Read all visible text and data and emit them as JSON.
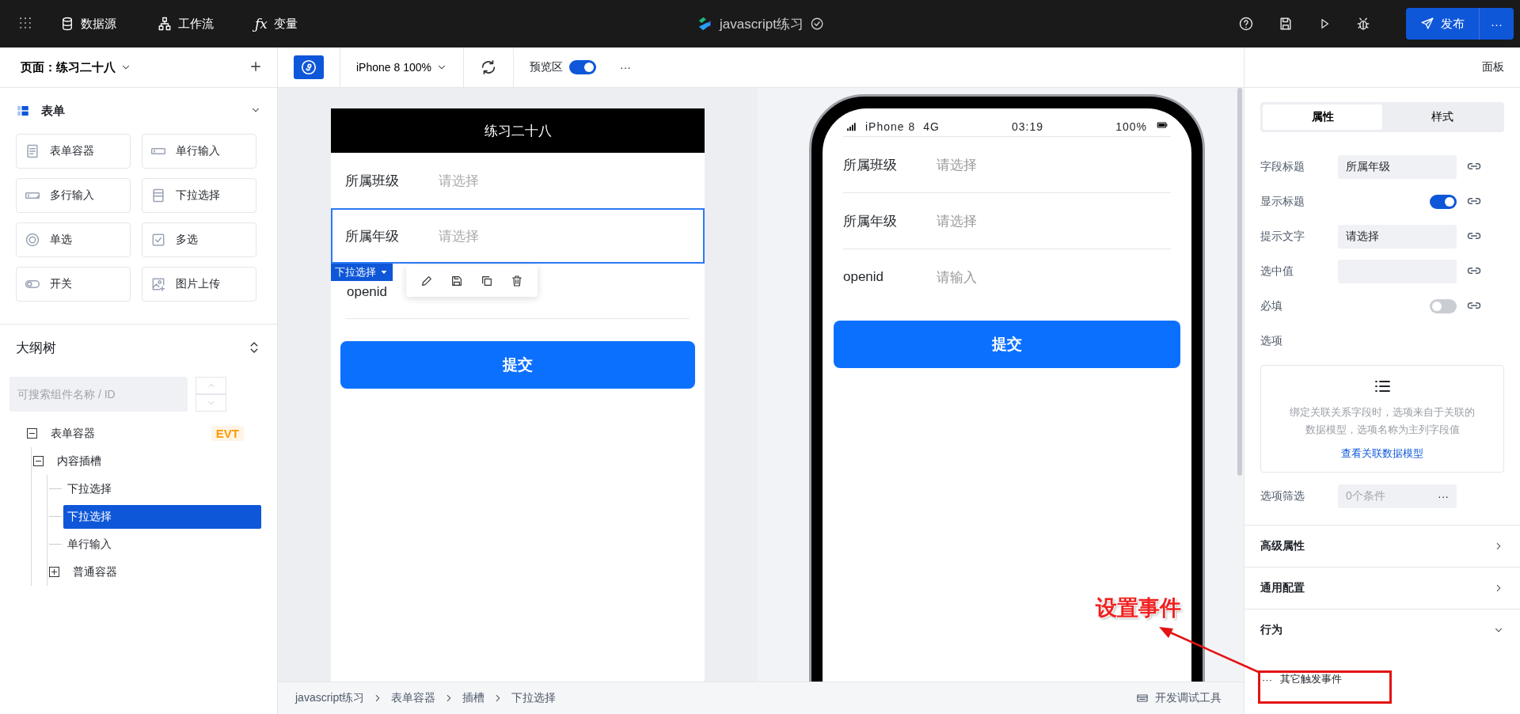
{
  "top_bar": {
    "nav": [
      {
        "kind": "database",
        "label": "数据源"
      },
      {
        "kind": "flow",
        "label": "工作流"
      },
      {
        "kind": "fx",
        "icon_text": "ƒx",
        "label": "变量"
      }
    ],
    "title": "javascript练习",
    "publish": "发布",
    "more": "···"
  },
  "page_bar": {
    "page": "页面：练习二十八",
    "device": "iPhone 8 100%",
    "preview_label": "预览区",
    "preview_on": true,
    "more": "···",
    "panel": "面板"
  },
  "components": {
    "title": "表单",
    "items": [
      {
        "kind": "form",
        "label": "表单容器"
      },
      {
        "kind": "input",
        "label": "单行输入"
      },
      {
        "kind": "textarea",
        "label": "多行输入"
      },
      {
        "kind": "select",
        "label": "下拉选择"
      },
      {
        "kind": "radio",
        "label": "单选"
      },
      {
        "kind": "checkbox",
        "label": "多选"
      },
      {
        "kind": "switch",
        "label": "开关"
      },
      {
        "kind": "image",
        "label": "图片上传"
      }
    ]
  },
  "outline": {
    "title": "大纲树",
    "search_placeholder": "可搜索组件名称 / ID",
    "tree": [
      {
        "label": "表单容器",
        "badge": "EVT",
        "expanded": true,
        "selected": false,
        "children": [
          {
            "label": "内容插槽",
            "expanded": true,
            "selected": false,
            "children": [
              {
                "label": "下拉选择",
                "selected": false
              },
              {
                "label": "下拉选择",
                "selected": true
              },
              {
                "label": "单行输入",
                "selected": false
              },
              {
                "label": "普通容器",
                "expanded": false,
                "selected": false
              }
            ]
          }
        ]
      }
    ]
  },
  "design": {
    "header": "练习二十八",
    "tag": "下拉选择",
    "fields": [
      {
        "label": "所属班级",
        "placeholder": "请选择",
        "selected": false
      },
      {
        "label": "所属年级",
        "placeholder": "请选择",
        "selected": true
      },
      {
        "label": "openid",
        "selected": false
      }
    ],
    "submit": "提交"
  },
  "phone": {
    "carrier": "iPhone 8",
    "network": "4G",
    "time": "03:19",
    "battery": "100%",
    "fields": [
      {
        "label": "所属班级",
        "placeholder": "请选择"
      },
      {
        "label": "所属年级",
        "placeholder": "请选择"
      },
      {
        "label": "openid",
        "placeholder": "请输入"
      }
    ],
    "submit": "提交"
  },
  "breadcrumb": {
    "items": [
      "javascript练习",
      "表单容器",
      "插槽",
      "下拉选择"
    ],
    "devtools": "开发调试工具"
  },
  "props": {
    "tabs": [
      {
        "label": "属性",
        "selected": true
      },
      {
        "label": "样式",
        "selected": false
      }
    ],
    "rows": [
      {
        "kind": "input",
        "label": "字段标题",
        "value": "所属年级"
      },
      {
        "kind": "toggle",
        "label": "显示标题",
        "on": true
      },
      {
        "kind": "input",
        "label": "提示文字",
        "value": "请选择"
      },
      {
        "kind": "input",
        "label": "选中值"
      },
      {
        "kind": "toggle",
        "label": "必填",
        "on": false
      }
    ],
    "options_label": "选项",
    "options_hint": "绑定关联关系字段时，选项来自于关联的数据模型，选项名称为主列字段值",
    "options_link": "查看关联数据模型",
    "filter_label": "选项筛选",
    "filter_value": "0个条件",
    "filter_more": "···",
    "sections": [
      {
        "title": "高级属性",
        "expanded": false
      },
      {
        "title": "通用配置",
        "expanded": false
      },
      {
        "title": "行为",
        "expanded": true,
        "items": [
          {
            "label": "其它触发事件",
            "more": "···"
          }
        ]
      }
    ]
  },
  "annotation": {
    "text": "设置事件"
  }
}
